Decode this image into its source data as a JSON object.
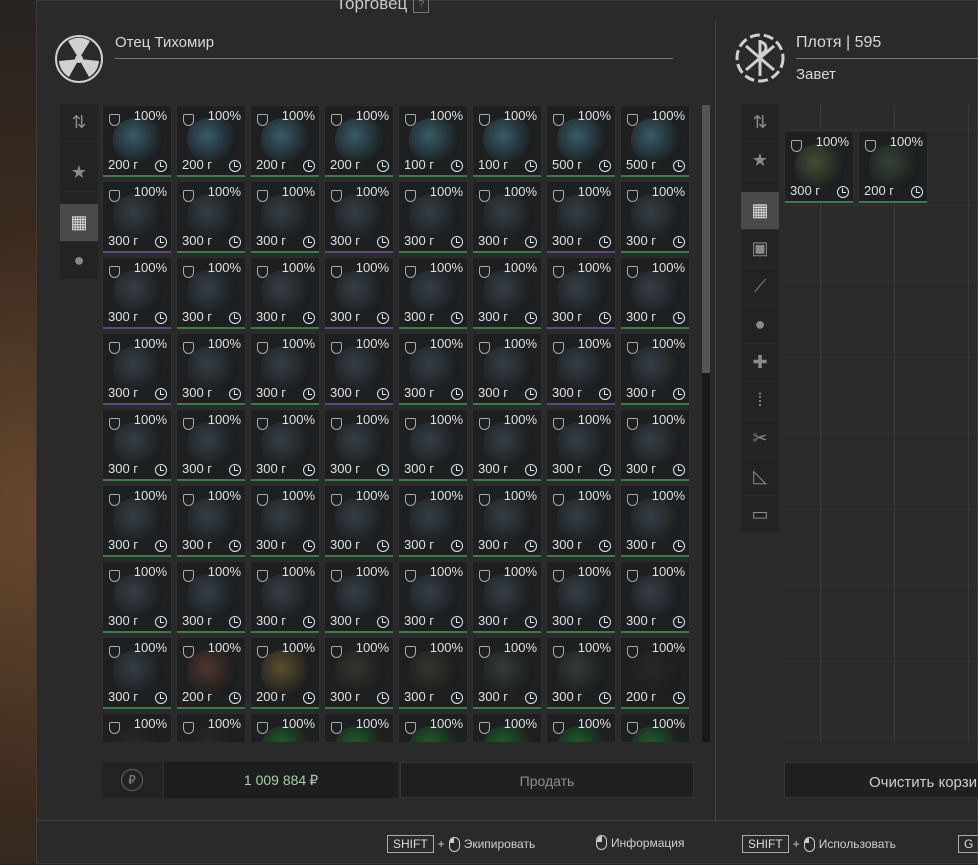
{
  "window": {
    "title": "Торговец",
    "help_label": "?"
  },
  "trader": {
    "name": "Отец Тихомир",
    "logo_icon": "radiation-icon"
  },
  "player": {
    "name": "Плотя",
    "separator": "|",
    "level": "595",
    "faction": "Завет",
    "logo_icon": "zavet-emblem-icon"
  },
  "trader_filters": [
    {
      "icon": "sort-icon",
      "glyph": "⇅",
      "active": false
    },
    {
      "icon": "star-icon",
      "glyph": "★",
      "active": false
    },
    {
      "icon": "grid-icon",
      "glyph": "▦",
      "active": true
    },
    {
      "icon": "artifact-icon",
      "glyph": "●",
      "active": false
    }
  ],
  "player_filters": [
    {
      "icon": "sort-icon",
      "glyph": "⇅",
      "active": false
    },
    {
      "icon": "star-icon",
      "glyph": "★",
      "active": false
    },
    {
      "icon": "grid-icon",
      "glyph": "▦",
      "active": true
    },
    {
      "icon": "backpack-icon",
      "glyph": "▣",
      "active": false
    },
    {
      "icon": "rifle-icon",
      "glyph": "⟋",
      "active": false
    },
    {
      "icon": "artifact-icon",
      "glyph": "●",
      "active": false
    },
    {
      "icon": "medkit-icon",
      "glyph": "✚",
      "active": false
    },
    {
      "icon": "ammo-icon",
      "glyph": "⁞",
      "active": false
    },
    {
      "icon": "tools-icon",
      "glyph": "✂",
      "active": false
    },
    {
      "icon": "ruler-icon",
      "glyph": "◺",
      "active": false
    },
    {
      "icon": "box-icon",
      "glyph": "▭",
      "active": false
    }
  ],
  "trader_rows": [
    {
      "weights": [
        "200 г",
        "200 г",
        "200 г",
        "200 г",
        "100 г",
        "100 г",
        "500 г",
        "500 г"
      ],
      "pct": "100%"
    },
    {
      "weights": [
        "300 г",
        "300 г",
        "300 г",
        "300 г",
        "300 г",
        "300 г",
        "300 г",
        "300 г"
      ],
      "pct": "100%"
    },
    {
      "weights": [
        "300 г",
        "300 г",
        "300 г",
        "300 г",
        "300 г",
        "300 г",
        "300 г",
        "300 г"
      ],
      "pct": "100%"
    },
    {
      "weights": [
        "300 г",
        "300 г",
        "300 г",
        "300 г",
        "300 г",
        "300 г",
        "300 г",
        "300 г"
      ],
      "pct": "100%"
    },
    {
      "weights": [
        "300 г",
        "300 г",
        "300 г",
        "300 г",
        "300 г",
        "300 г",
        "300 г",
        "300 г"
      ],
      "pct": "100%"
    },
    {
      "weights": [
        "300 г",
        "300 г",
        "300 г",
        "300 г",
        "300 г",
        "300 г",
        "300 г",
        "300 г"
      ],
      "pct": "100%"
    },
    {
      "weights": [
        "300 г",
        "300 г",
        "300 г",
        "300 г",
        "300 г",
        "300 г",
        "300 г",
        "300 г"
      ],
      "pct": "100%"
    },
    {
      "weights": [
        "300 г",
        "200 г",
        "200 г",
        "300 г",
        "300 г",
        "300 г",
        "300 г",
        "200 г"
      ],
      "pct": "100%"
    },
    {
      "weights": [
        "",
        "",
        "",
        "",
        "",
        "",
        "",
        ""
      ],
      "pct": "100%"
    }
  ],
  "player_items": [
    {
      "weight": "300 г",
      "pct": "100%"
    },
    {
      "weight": "200 г",
      "pct": "100%"
    }
  ],
  "colors": {
    "row0": "#3f6a7a",
    "row_default": "#3a4650",
    "row7": [
      "#3a4650",
      "#5a3a30",
      "#6a5a30",
      "#3a3a30",
      "#3a3a30",
      "#3a4040",
      "#3a4040",
      "#2a2a2a"
    ],
    "bar_green": "#3f7a4a",
    "bar_purple": "#5a4a7a",
    "money": "#9fd59f"
  },
  "footer": {
    "balance": "1 009 884",
    "currency": "₽",
    "sell_label": "Продать",
    "clear_label": "Очистить корзи"
  },
  "hints": [
    {
      "key": "SHIFT",
      "plus": "+",
      "action": "Экипировать"
    },
    {
      "action": "Информация"
    },
    {
      "key": "SHIFT",
      "plus": "+",
      "action": "Использовать"
    },
    {
      "key": "G"
    }
  ]
}
